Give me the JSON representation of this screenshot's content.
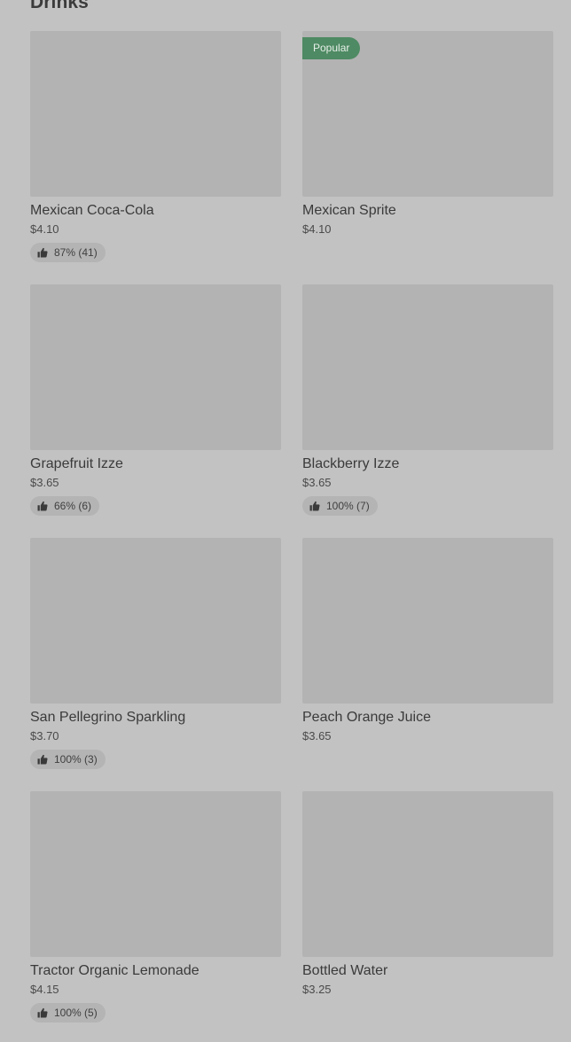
{
  "section": {
    "title": "Drinks"
  },
  "items": [
    {
      "name": "Mexican Coca-Cola",
      "price": "$4.10",
      "badge": "",
      "rating": "87% (41)"
    },
    {
      "name": "Mexican Sprite",
      "price": "$4.10",
      "badge": "Popular",
      "rating": ""
    },
    {
      "name": "Grapefruit Izze",
      "price": "$3.65",
      "badge": "",
      "rating": "66% (6)"
    },
    {
      "name": "Blackberry Izze",
      "price": "$3.65",
      "badge": "",
      "rating": "100% (7)"
    },
    {
      "name": "San Pellegrino Sparkling",
      "price": "$3.70",
      "badge": "",
      "rating": "100% (3)"
    },
    {
      "name": "Peach Orange Juice",
      "price": "$3.65",
      "badge": "",
      "rating": ""
    },
    {
      "name": "Tractor Organic Lemonade",
      "price": "$4.15",
      "badge": "",
      "rating": "100% (5)"
    },
    {
      "name": "Bottled Water",
      "price": "$3.25",
      "badge": "",
      "rating": ""
    }
  ],
  "icons": {
    "rating": "thumbs-up-icon"
  },
  "colors": {
    "background": "#c2c2c2",
    "image_placeholder": "#b3b3b3",
    "badge": "#4e8a63",
    "rating_pill": "#b4b4b4"
  }
}
